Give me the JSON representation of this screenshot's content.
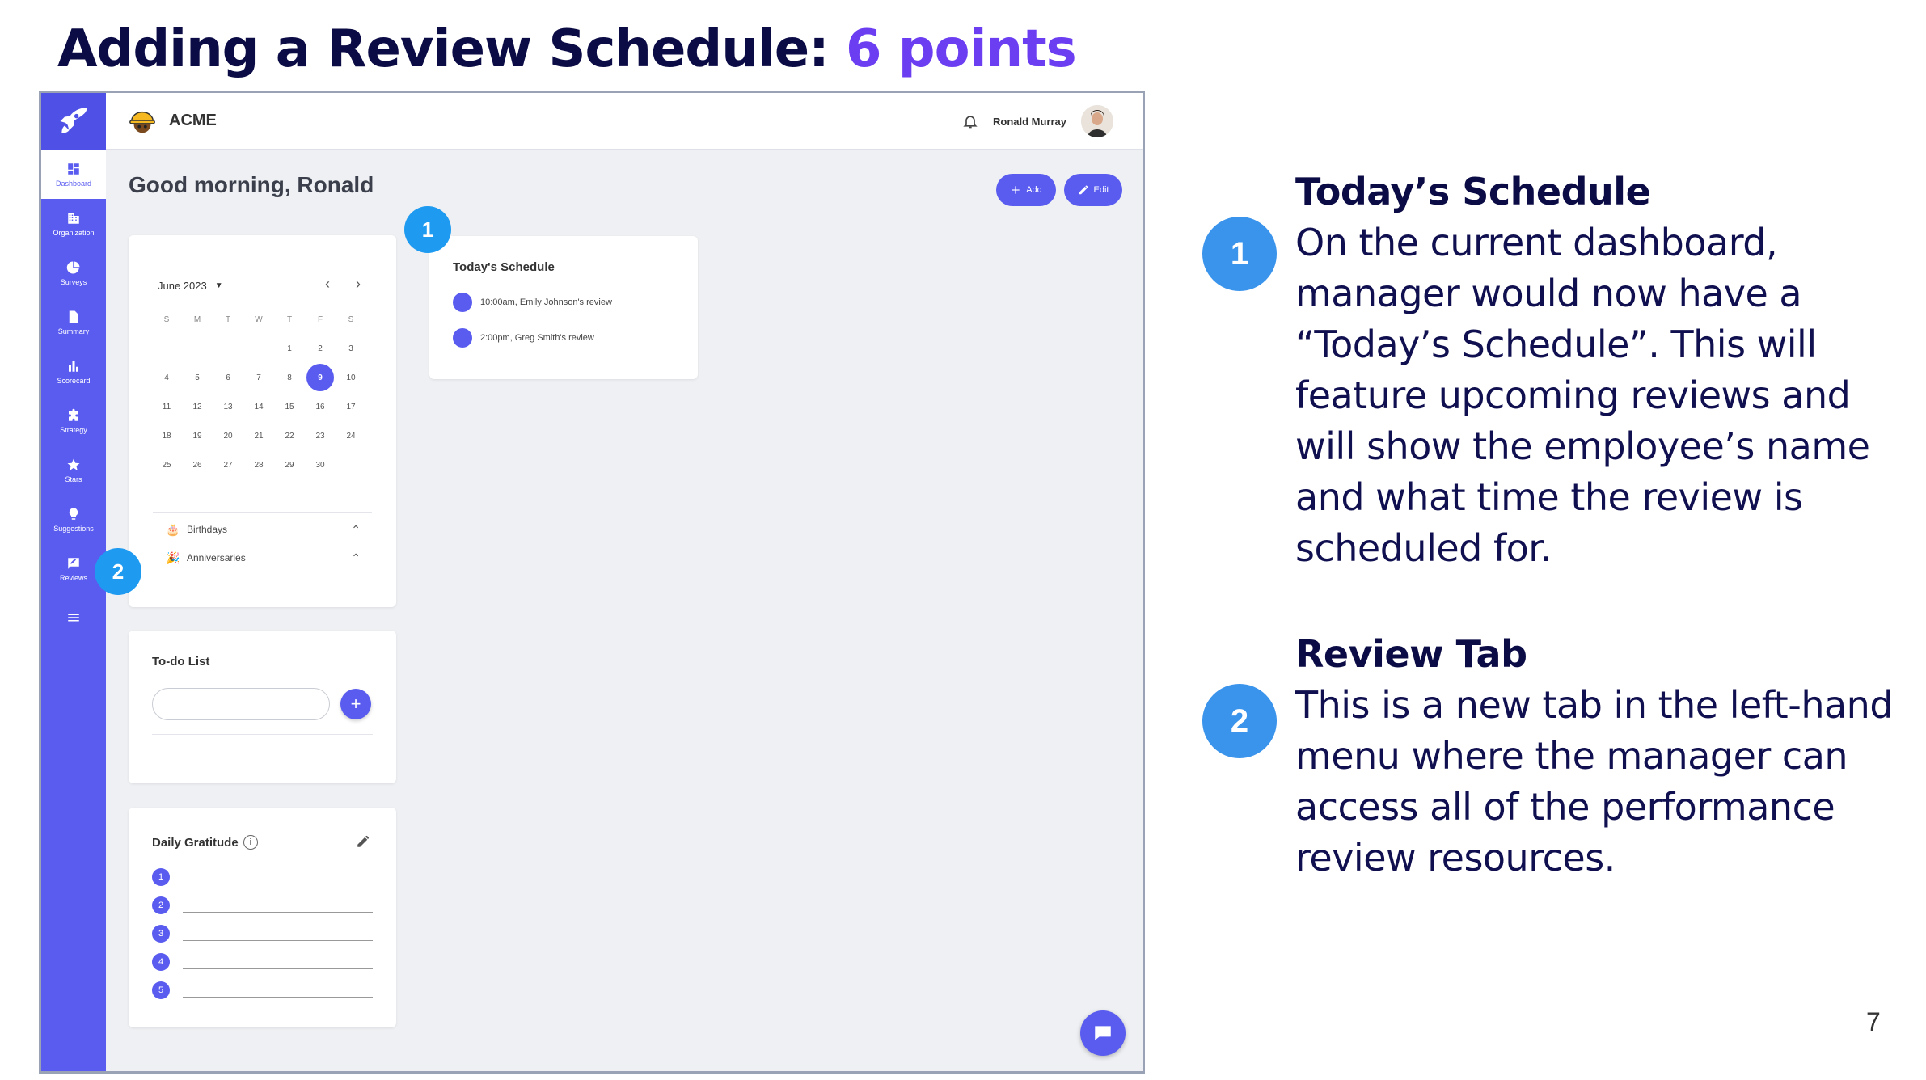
{
  "slide": {
    "title_main": "Adding a Review Schedule:",
    "title_accent": "6 points",
    "page_number": "7",
    "accent_color": "#6c3ef2"
  },
  "sidebar": {
    "items": [
      {
        "label": "Dashboard",
        "icon": "dashboard-icon",
        "active": true
      },
      {
        "label": "Organization",
        "icon": "organization-icon"
      },
      {
        "label": "Surveys",
        "icon": "pie-chart-icon"
      },
      {
        "label": "Summary",
        "icon": "document-icon"
      },
      {
        "label": "Scorecard",
        "icon": "bar-chart-icon"
      },
      {
        "label": "Strategy",
        "icon": "puzzle-icon"
      },
      {
        "label": "Stars",
        "icon": "star-icon"
      },
      {
        "label": "Suggestions",
        "icon": "lightbulb-icon"
      },
      {
        "label": "Reviews",
        "icon": "reviews-icon"
      }
    ],
    "color": "#5a5cf0"
  },
  "topbar": {
    "brand": "ACME",
    "user_name": "Ronald Murray"
  },
  "main": {
    "greeting": "Good morning, Ronald",
    "add_label": "Add",
    "edit_label": "Edit"
  },
  "calendar": {
    "month": "June 2023",
    "weekdays": [
      "S",
      "M",
      "T",
      "W",
      "T",
      "F",
      "S"
    ],
    "leading_blanks": 4,
    "days_in_month": 30,
    "selected_day": 9,
    "birthdays_label": "Birthdays",
    "anniversaries_label": "Anniversaries"
  },
  "schedule": {
    "title": "Today's Schedule",
    "items": [
      "10:00am, Emily Johnson's review",
      "2:00pm, Greg Smith's review"
    ]
  },
  "todo": {
    "title": "To-do List",
    "input_value": ""
  },
  "gratitude": {
    "title": "Daily Gratitude",
    "numbers": [
      "1",
      "2",
      "3",
      "4",
      "5"
    ]
  },
  "markers": {
    "one": "1",
    "two": "2"
  },
  "callouts": [
    {
      "number": "1",
      "heading": "Today’s Schedule",
      "lines": [
        "On the current dashboard,",
        "manager would now have a",
        "“Today’s Schedule”. This will",
        "feature upcoming reviews and",
        "will show the employee’s name",
        "and what time the review is",
        "scheduled for."
      ]
    },
    {
      "number": "2",
      "heading": "Review Tab",
      "lines": [
        "This is a new tab in the left-hand",
        "menu where the manager can",
        "access all of the performance",
        "review resources."
      ]
    }
  ]
}
